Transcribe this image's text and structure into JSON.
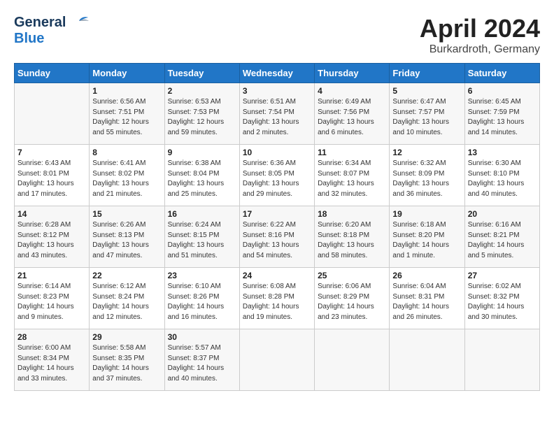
{
  "header": {
    "logo_line1": "General",
    "logo_line2": "Blue",
    "month": "April 2024",
    "location": "Burkardroth, Germany"
  },
  "weekdays": [
    "Sunday",
    "Monday",
    "Tuesday",
    "Wednesday",
    "Thursday",
    "Friday",
    "Saturday"
  ],
  "weeks": [
    [
      {
        "day": "",
        "info": ""
      },
      {
        "day": "1",
        "info": "Sunrise: 6:56 AM\nSunset: 7:51 PM\nDaylight: 12 hours\nand 55 minutes."
      },
      {
        "day": "2",
        "info": "Sunrise: 6:53 AM\nSunset: 7:53 PM\nDaylight: 12 hours\nand 59 minutes."
      },
      {
        "day": "3",
        "info": "Sunrise: 6:51 AM\nSunset: 7:54 PM\nDaylight: 13 hours\nand 2 minutes."
      },
      {
        "day": "4",
        "info": "Sunrise: 6:49 AM\nSunset: 7:56 PM\nDaylight: 13 hours\nand 6 minutes."
      },
      {
        "day": "5",
        "info": "Sunrise: 6:47 AM\nSunset: 7:57 PM\nDaylight: 13 hours\nand 10 minutes."
      },
      {
        "day": "6",
        "info": "Sunrise: 6:45 AM\nSunset: 7:59 PM\nDaylight: 13 hours\nand 14 minutes."
      }
    ],
    [
      {
        "day": "7",
        "info": "Sunrise: 6:43 AM\nSunset: 8:01 PM\nDaylight: 13 hours\nand 17 minutes."
      },
      {
        "day": "8",
        "info": "Sunrise: 6:41 AM\nSunset: 8:02 PM\nDaylight: 13 hours\nand 21 minutes."
      },
      {
        "day": "9",
        "info": "Sunrise: 6:38 AM\nSunset: 8:04 PM\nDaylight: 13 hours\nand 25 minutes."
      },
      {
        "day": "10",
        "info": "Sunrise: 6:36 AM\nSunset: 8:05 PM\nDaylight: 13 hours\nand 29 minutes."
      },
      {
        "day": "11",
        "info": "Sunrise: 6:34 AM\nSunset: 8:07 PM\nDaylight: 13 hours\nand 32 minutes."
      },
      {
        "day": "12",
        "info": "Sunrise: 6:32 AM\nSunset: 8:09 PM\nDaylight: 13 hours\nand 36 minutes."
      },
      {
        "day": "13",
        "info": "Sunrise: 6:30 AM\nSunset: 8:10 PM\nDaylight: 13 hours\nand 40 minutes."
      }
    ],
    [
      {
        "day": "14",
        "info": "Sunrise: 6:28 AM\nSunset: 8:12 PM\nDaylight: 13 hours\nand 43 minutes."
      },
      {
        "day": "15",
        "info": "Sunrise: 6:26 AM\nSunset: 8:13 PM\nDaylight: 13 hours\nand 47 minutes."
      },
      {
        "day": "16",
        "info": "Sunrise: 6:24 AM\nSunset: 8:15 PM\nDaylight: 13 hours\nand 51 minutes."
      },
      {
        "day": "17",
        "info": "Sunrise: 6:22 AM\nSunset: 8:16 PM\nDaylight: 13 hours\nand 54 minutes."
      },
      {
        "day": "18",
        "info": "Sunrise: 6:20 AM\nSunset: 8:18 PM\nDaylight: 13 hours\nand 58 minutes."
      },
      {
        "day": "19",
        "info": "Sunrise: 6:18 AM\nSunset: 8:20 PM\nDaylight: 14 hours\nand 1 minute."
      },
      {
        "day": "20",
        "info": "Sunrise: 6:16 AM\nSunset: 8:21 PM\nDaylight: 14 hours\nand 5 minutes."
      }
    ],
    [
      {
        "day": "21",
        "info": "Sunrise: 6:14 AM\nSunset: 8:23 PM\nDaylight: 14 hours\nand 9 minutes."
      },
      {
        "day": "22",
        "info": "Sunrise: 6:12 AM\nSunset: 8:24 PM\nDaylight: 14 hours\nand 12 minutes."
      },
      {
        "day": "23",
        "info": "Sunrise: 6:10 AM\nSunset: 8:26 PM\nDaylight: 14 hours\nand 16 minutes."
      },
      {
        "day": "24",
        "info": "Sunrise: 6:08 AM\nSunset: 8:28 PM\nDaylight: 14 hours\nand 19 minutes."
      },
      {
        "day": "25",
        "info": "Sunrise: 6:06 AM\nSunset: 8:29 PM\nDaylight: 14 hours\nand 23 minutes."
      },
      {
        "day": "26",
        "info": "Sunrise: 6:04 AM\nSunset: 8:31 PM\nDaylight: 14 hours\nand 26 minutes."
      },
      {
        "day": "27",
        "info": "Sunrise: 6:02 AM\nSunset: 8:32 PM\nDaylight: 14 hours\nand 30 minutes."
      }
    ],
    [
      {
        "day": "28",
        "info": "Sunrise: 6:00 AM\nSunset: 8:34 PM\nDaylight: 14 hours\nand 33 minutes."
      },
      {
        "day": "29",
        "info": "Sunrise: 5:58 AM\nSunset: 8:35 PM\nDaylight: 14 hours\nand 37 minutes."
      },
      {
        "day": "30",
        "info": "Sunrise: 5:57 AM\nSunset: 8:37 PM\nDaylight: 14 hours\nand 40 minutes."
      },
      {
        "day": "",
        "info": ""
      },
      {
        "day": "",
        "info": ""
      },
      {
        "day": "",
        "info": ""
      },
      {
        "day": "",
        "info": ""
      }
    ]
  ]
}
